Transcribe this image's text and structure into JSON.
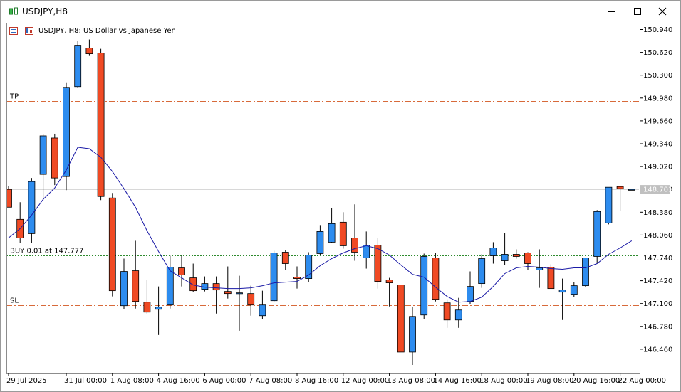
{
  "window": {
    "title": "USDJPY,H8",
    "controls": [
      "minimize",
      "maximize",
      "close"
    ]
  },
  "chart_header": {
    "text": "USDJPY, H8:  US Dollar vs Japanese Yen"
  },
  "colors": {
    "bull": "#2d8cef",
    "bear": "#f04a24",
    "ma": "#1a1aa6",
    "level_tp_sl": "#d86a3a",
    "level_buy": "#2e8b2e",
    "bid_line": "#c0c0c0",
    "price_tag_bg": "#c0c0c0"
  },
  "levels": [
    {
      "label": "TP",
      "price": 149.94,
      "style": "dash-dot",
      "color": "#d86a3a"
    },
    {
      "label": "BUY 0.01 at 147.777",
      "price": 147.777,
      "style": "dotted",
      "color": "#2e8b2e"
    },
    {
      "label": "SL",
      "price": 147.08,
      "style": "dash-dot",
      "color": "#d86a3a"
    }
  ],
  "current_price": {
    "label": "148.701",
    "value": 148.701
  },
  "chart_data": {
    "type": "candlestick",
    "symbol": "USDJPY",
    "timeframe": "H8",
    "title": "US Dollar vs Japanese Yen",
    "ylim": [
      146.18,
      151.06
    ],
    "y_ticks": [
      "150.940",
      "150.620",
      "150.300",
      "149.980",
      "149.660",
      "149.340",
      "149.020",
      "148.700",
      "148.380",
      "148.060",
      "147.740",
      "147.420",
      "147.100",
      "146.780",
      "146.460"
    ],
    "x_ticks": [
      {
        "label": "29 Jul 2025",
        "index": 0
      },
      {
        "label": "31 Jul 00:00",
        "index": 5
      },
      {
        "label": "1 Aug 08:00",
        "index": 9
      },
      {
        "label": "4 Aug 16:00",
        "index": 13
      },
      {
        "label": "6 Aug 00:00",
        "index": 17
      },
      {
        "label": "7 Aug 08:00",
        "index": 21
      },
      {
        "label": "8 Aug 16:00",
        "index": 25
      },
      {
        "label": "12 Aug 00:00",
        "index": 29
      },
      {
        "label": "13 Aug 08:00",
        "index": 33
      },
      {
        "label": "14 Aug 16:00",
        "index": 37
      },
      {
        "label": "18 Aug 00:00",
        "index": 41
      },
      {
        "label": "19 Aug 08:00",
        "index": 45
      },
      {
        "label": "20 Aug 16:00",
        "index": 49
      },
      {
        "label": "22 Aug 00:00",
        "index": 53
      }
    ],
    "candles": [
      {
        "o": 148.7,
        "h": 148.75,
        "l": 148.48,
        "c": 148.45
      },
      {
        "o": 148.28,
        "h": 148.52,
        "l": 147.95,
        "c": 148.02
      },
      {
        "o": 148.08,
        "h": 148.86,
        "l": 147.95,
        "c": 148.81
      },
      {
        "o": 148.91,
        "h": 149.48,
        "l": 148.55,
        "c": 149.45
      },
      {
        "o": 149.42,
        "h": 149.48,
        "l": 148.76,
        "c": 148.86
      },
      {
        "o": 148.88,
        "h": 150.2,
        "l": 148.69,
        "c": 150.13
      },
      {
        "o": 150.14,
        "h": 150.78,
        "l": 150.12,
        "c": 150.72
      },
      {
        "o": 150.68,
        "h": 150.8,
        "l": 150.57,
        "c": 150.6
      },
      {
        "o": 150.61,
        "h": 150.67,
        "l": 148.55,
        "c": 148.6
      },
      {
        "o": 148.58,
        "h": 148.65,
        "l": 147.2,
        "c": 147.28
      },
      {
        "o": 147.07,
        "h": 147.73,
        "l": 147.02,
        "c": 147.55
      },
      {
        "o": 147.56,
        "h": 147.98,
        "l": 147.03,
        "c": 147.13
      },
      {
        "o": 147.12,
        "h": 147.43,
        "l": 146.96,
        "c": 146.98
      },
      {
        "o": 147.02,
        "h": 147.34,
        "l": 146.66,
        "c": 147.05
      },
      {
        "o": 147.08,
        "h": 147.77,
        "l": 147.03,
        "c": 147.61
      },
      {
        "o": 147.6,
        "h": 147.77,
        "l": 147.34,
        "c": 147.5
      },
      {
        "o": 147.46,
        "h": 147.66,
        "l": 147.26,
        "c": 147.28
      },
      {
        "o": 147.3,
        "h": 147.48,
        "l": 147.27,
        "c": 147.38
      },
      {
        "o": 147.38,
        "h": 147.48,
        "l": 146.96,
        "c": 147.29
      },
      {
        "o": 147.27,
        "h": 147.62,
        "l": 147.17,
        "c": 147.24
      },
      {
        "o": 147.24,
        "h": 147.49,
        "l": 146.72,
        "c": 147.25
      },
      {
        "o": 147.24,
        "h": 147.35,
        "l": 146.93,
        "c": 147.08
      },
      {
        "o": 146.93,
        "h": 147.28,
        "l": 146.88,
        "c": 147.08
      },
      {
        "o": 147.14,
        "h": 147.84,
        "l": 147.12,
        "c": 147.81
      },
      {
        "o": 147.82,
        "h": 147.85,
        "l": 147.57,
        "c": 147.66
      },
      {
        "o": 147.47,
        "h": 147.62,
        "l": 147.31,
        "c": 147.45
      },
      {
        "o": 147.45,
        "h": 147.82,
        "l": 147.4,
        "c": 147.78
      },
      {
        "o": 147.8,
        "h": 148.2,
        "l": 147.78,
        "c": 148.11
      },
      {
        "o": 147.96,
        "h": 148.44,
        "l": 147.95,
        "c": 148.22
      },
      {
        "o": 148.24,
        "h": 148.38,
        "l": 147.87,
        "c": 147.91
      },
      {
        "o": 148.02,
        "h": 148.49,
        "l": 147.7,
        "c": 147.82
      },
      {
        "o": 147.74,
        "h": 148.11,
        "l": 147.59,
        "c": 147.92
      },
      {
        "o": 147.92,
        "h": 148.02,
        "l": 147.31,
        "c": 147.41
      },
      {
        "o": 147.43,
        "h": 147.46,
        "l": 147.06,
        "c": 147.39
      },
      {
        "o": 147.36,
        "h": 147.36,
        "l": 146.42,
        "c": 146.42
      },
      {
        "o": 146.42,
        "h": 147.05,
        "l": 146.24,
        "c": 146.92
      },
      {
        "o": 146.94,
        "h": 147.8,
        "l": 146.88,
        "c": 147.76
      },
      {
        "o": 147.74,
        "h": 147.81,
        "l": 147.13,
        "c": 147.16
      },
      {
        "o": 147.11,
        "h": 147.16,
        "l": 146.76,
        "c": 146.87
      },
      {
        "o": 146.87,
        "h": 147.18,
        "l": 146.76,
        "c": 147.01
      },
      {
        "o": 147.13,
        "h": 147.55,
        "l": 147.09,
        "c": 147.34
      },
      {
        "o": 147.38,
        "h": 147.79,
        "l": 147.32,
        "c": 147.73
      },
      {
        "o": 147.77,
        "h": 147.96,
        "l": 147.66,
        "c": 147.88
      },
      {
        "o": 147.7,
        "h": 148.09,
        "l": 147.64,
        "c": 147.79
      },
      {
        "o": 147.79,
        "h": 147.86,
        "l": 147.73,
        "c": 147.76
      },
      {
        "o": 147.81,
        "h": 147.82,
        "l": 147.57,
        "c": 147.66
      },
      {
        "o": 147.57,
        "h": 147.86,
        "l": 147.32,
        "c": 147.6
      },
      {
        "o": 147.61,
        "h": 147.65,
        "l": 147.32,
        "c": 147.31
      },
      {
        "o": 147.26,
        "h": 147.45,
        "l": 146.87,
        "c": 147.29
      },
      {
        "o": 147.23,
        "h": 147.4,
        "l": 147.19,
        "c": 147.35
      },
      {
        "o": 147.35,
        "h": 147.74,
        "l": 147.33,
        "c": 147.74
      },
      {
        "o": 147.76,
        "h": 148.41,
        "l": 147.66,
        "c": 148.39
      },
      {
        "o": 148.23,
        "h": 148.73,
        "l": 148.21,
        "c": 148.73
      },
      {
        "o": 148.74,
        "h": 148.75,
        "l": 148.4,
        "c": 148.71
      },
      {
        "o": 148.7,
        "h": 148.71,
        "l": 148.7,
        "c": 148.7
      }
    ],
    "moving_average": [
      {
        "i": 0,
        "v": 148.02
      },
      {
        "i": 1,
        "v": 148.15
      },
      {
        "i": 2,
        "v": 148.34
      },
      {
        "i": 3,
        "v": 148.56
      },
      {
        "i": 4,
        "v": 148.72
      },
      {
        "i": 5,
        "v": 148.97
      },
      {
        "i": 6,
        "v": 149.29
      },
      {
        "i": 7,
        "v": 149.27
      },
      {
        "i": 8,
        "v": 149.15
      },
      {
        "i": 9,
        "v": 148.95
      },
      {
        "i": 10,
        "v": 148.71
      },
      {
        "i": 11,
        "v": 148.45
      },
      {
        "i": 12,
        "v": 148.12
      },
      {
        "i": 13,
        "v": 147.83
      },
      {
        "i": 14,
        "v": 147.56
      },
      {
        "i": 15,
        "v": 147.46
      },
      {
        "i": 16,
        "v": 147.36
      },
      {
        "i": 17,
        "v": 147.33
      },
      {
        "i": 18,
        "v": 147.32
      },
      {
        "i": 19,
        "v": 147.31
      },
      {
        "i": 20,
        "v": 147.31
      },
      {
        "i": 21,
        "v": 147.32
      },
      {
        "i": 22,
        "v": 147.35
      },
      {
        "i": 23,
        "v": 147.39
      },
      {
        "i": 24,
        "v": 147.4
      },
      {
        "i": 25,
        "v": 147.41
      },
      {
        "i": 26,
        "v": 147.5
      },
      {
        "i": 27,
        "v": 147.63
      },
      {
        "i": 28,
        "v": 147.73
      },
      {
        "i": 29,
        "v": 147.81
      },
      {
        "i": 30,
        "v": 147.87
      },
      {
        "i": 31,
        "v": 147.91
      },
      {
        "i": 32,
        "v": 147.87
      },
      {
        "i": 33,
        "v": 147.78
      },
      {
        "i": 34,
        "v": 147.64
      },
      {
        "i": 35,
        "v": 147.51
      },
      {
        "i": 36,
        "v": 147.47
      },
      {
        "i": 37,
        "v": 147.33
      },
      {
        "i": 38,
        "v": 147.2
      },
      {
        "i": 39,
        "v": 147.12
      },
      {
        "i": 40,
        "v": 147.13
      },
      {
        "i": 41,
        "v": 147.19
      },
      {
        "i": 42,
        "v": 147.34
      },
      {
        "i": 43,
        "v": 147.52
      },
      {
        "i": 44,
        "v": 147.6
      },
      {
        "i": 45,
        "v": 147.62
      },
      {
        "i": 46,
        "v": 147.61
      },
      {
        "i": 47,
        "v": 147.59
      },
      {
        "i": 48,
        "v": 147.58
      },
      {
        "i": 49,
        "v": 147.6
      },
      {
        "i": 50,
        "v": 147.6
      },
      {
        "i": 51,
        "v": 147.66
      },
      {
        "i": 52,
        "v": 147.79
      },
      {
        "i": 53,
        "v": 147.88
      },
      {
        "i": 54,
        "v": 147.98
      }
    ]
  }
}
